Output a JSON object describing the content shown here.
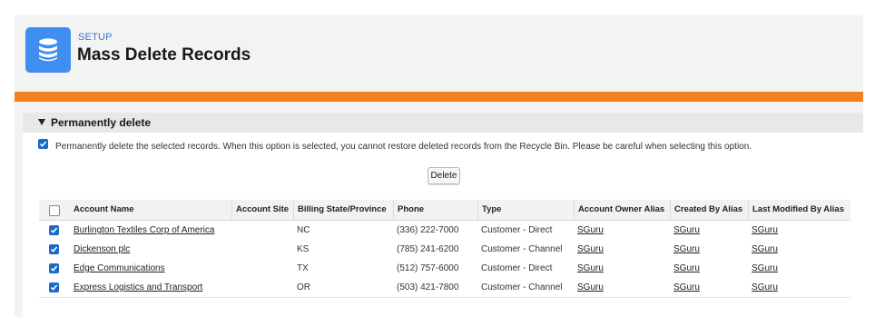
{
  "header": {
    "setup_label": "SETUP",
    "title": "Mass Delete Records",
    "icon": "database-icon",
    "icon_color": "#3f8ef0"
  },
  "accent_color": "#f08021",
  "section": {
    "title": "Permanently delete",
    "option_checked": true,
    "option_text": "Permanently delete the selected records. When this option is selected, you cannot restore deleted records from the Recycle Bin. Please be careful when selecting this option.",
    "delete_label": "Delete"
  },
  "table": {
    "columns": [
      "Account Name",
      "Account Site",
      "Billing State/Province",
      "Phone",
      "Type",
      "Account Owner Alias",
      "Created By Alias",
      "Last Modified By Alias"
    ],
    "select_all_checked": false,
    "rows": [
      {
        "checked": true,
        "name": "Burlington Textiles Corp of America",
        "site": "",
        "state": "NC",
        "phone": "(336) 222-7000",
        "type": "Customer - Direct",
        "owner": "SGuru",
        "created": "SGuru",
        "modified": "SGuru"
      },
      {
        "checked": true,
        "name": "Dickenson plc",
        "site": "",
        "state": "KS",
        "phone": "(785) 241-6200",
        "type": "Customer - Channel",
        "owner": "SGuru",
        "created": "SGuru",
        "modified": "SGuru"
      },
      {
        "checked": true,
        "name": "Edge Communications",
        "site": "",
        "state": "TX",
        "phone": "(512) 757-6000",
        "type": "Customer - Direct",
        "owner": "SGuru",
        "created": "SGuru",
        "modified": "SGuru"
      },
      {
        "checked": true,
        "name": "Express Logistics and Transport",
        "site": "",
        "state": "OR",
        "phone": "(503) 421-7800",
        "type": "Customer - Channel",
        "owner": "SGuru",
        "created": "SGuru",
        "modified": "SGuru"
      }
    ]
  }
}
